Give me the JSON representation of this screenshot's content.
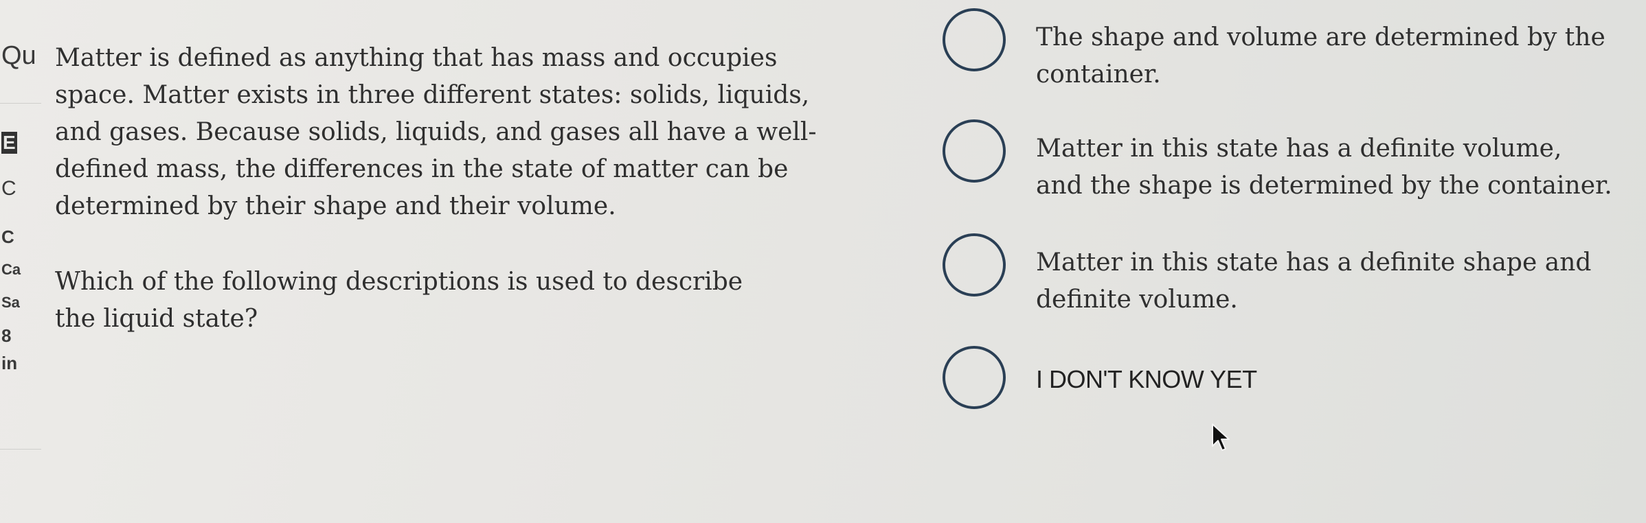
{
  "sidebar": {
    "fragments": [
      "Qu",
      "E",
      "C",
      "C",
      "Ca",
      "Sa",
      "8",
      "in"
    ]
  },
  "question": {
    "paragraph": "Matter is defined as anything that has mass and occupies space. Matter exists in three different states: solids, liquids, and gases. Because solids, liquids, and gases all have a well-defined mass, the differences in the state of matter can be determined by their shape and their volume.",
    "prompt": "Which of the following descriptions is used to describe the liquid state?"
  },
  "options": [
    {
      "label": "The shape and volume are determined by the container."
    },
    {
      "label": "Matter in this state has a definite volume, and the shape is determined by the container."
    },
    {
      "label": "Matter in this state has a definite shape and definite volume."
    },
    {
      "label": "I DON'T KNOW YET"
    }
  ]
}
